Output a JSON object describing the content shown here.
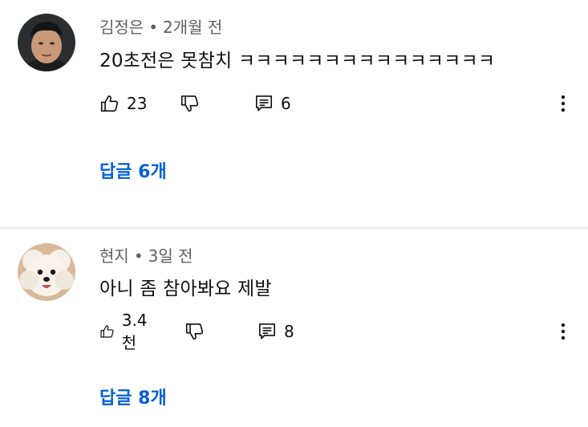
{
  "comments": [
    {
      "author": "김정은",
      "separator": "•",
      "time": "2개월 전",
      "text": "20초전은 못참치 ㅋㅋㅋㅋㅋㅋㅋㅋㅋㅋㅋㅋㅋㅋㅋ",
      "likes": "23",
      "reply_count": "6",
      "replies_label": "답글 6개",
      "avatar_icon": "man-portrait-avatar"
    },
    {
      "author": "현지",
      "separator": "•",
      "time": "3일 전",
      "text": "아니 좀 참아봐요 제발",
      "likes": "3.4천",
      "reply_count": "8",
      "replies_label": "답글 8개",
      "avatar_icon": "white-dog-avatar"
    }
  ],
  "colors": {
    "link": "#065fd4",
    "meta": "#606060",
    "divider": "#f2f2f2"
  },
  "icons": [
    "thumbs-up-icon",
    "thumbs-down-icon",
    "reply-icon",
    "more-vert-icon"
  ]
}
